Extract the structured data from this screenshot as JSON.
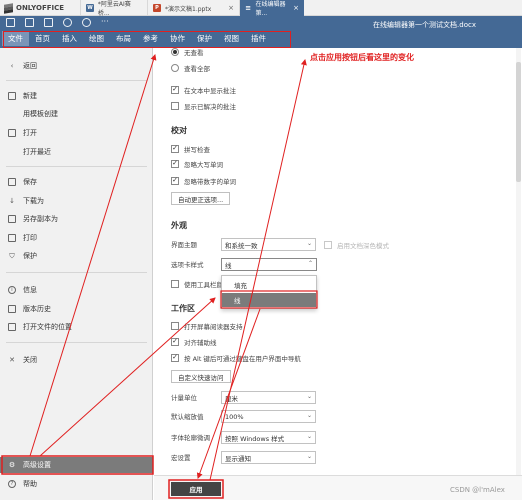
{
  "browser_tabs": [
    {
      "label": "ONLYOFFICE"
    },
    {
      "label": "*阿里云AI赛桥...",
      "badge": "W",
      "badge_color": "#446995"
    },
    {
      "label": "*演示文稿1.pptx",
      "badge": "P",
      "badge_color": "#c4472b"
    },
    {
      "label": "在线编辑器第...",
      "badge": "≡",
      "active": true
    }
  ],
  "header": {
    "doc_title": "在线编辑器第一个测试文档.docx",
    "qa_more": "···",
    "menu": [
      "文件",
      "首页",
      "插入",
      "绘图",
      "布局",
      "参考",
      "协作",
      "保护",
      "视图",
      "插件"
    ]
  },
  "left_panel": {
    "back": "返回",
    "items": [
      "新建",
      "用模板创建",
      "打开",
      "打开最近",
      "保存",
      "下载为",
      "另存副本为",
      "打印",
      "保护",
      "信息",
      "版本历史",
      "打开文件的位置",
      "关闭",
      "高级设置",
      "帮助"
    ]
  },
  "settings": {
    "top_radio_1": "无查看",
    "top_radio_2": "查看全部",
    "comments_show": "在文本中显示批注",
    "comments_resolved": "显示已解决的批注",
    "proofing": {
      "title": "校对",
      "spellcheck": "拼写检查",
      "ignore_upper": "忽略大写单词",
      "ignore_numbers": "忽略带数字的单词",
      "autocorrect_btn": "自动更正选项..."
    },
    "appearance": {
      "title": "外观",
      "theme_label": "界面主题",
      "theme_value": "和系统一致",
      "dark_doc": "启用文档深色模式",
      "tab_style_label": "选项卡样式",
      "tab_style_value": "线",
      "toolbar_option": "使用工具栏颜色",
      "dropdown_options": [
        "填充",
        "线"
      ]
    },
    "workspace": {
      "title": "工作区",
      "screen_reader": "打开屏幕阅读器支持",
      "alignment_guides": "对齐辅助线",
      "alt_key": "按 Alt 键后可通过键盘在用户界面中导航",
      "quick_access_btn": "自定义快速访问",
      "unit_label": "计量单位",
      "unit_value": "厘米",
      "zoom_label": "默认缩放值",
      "zoom_value": "100%",
      "hinting_label": "字体轮廓微调",
      "hinting_value": "按照 Windows 样式",
      "macros_label": "宏设置",
      "macros_value": "显示通知"
    },
    "apply_btn": "应用"
  },
  "annotation": "点击应用按钮后看这里的变化",
  "watermark": "CSDN @l'mAlex",
  "colors": {
    "header_blue": "#446995",
    "annotation_red": "#e02020",
    "active_gray": "#7b7b7b"
  }
}
